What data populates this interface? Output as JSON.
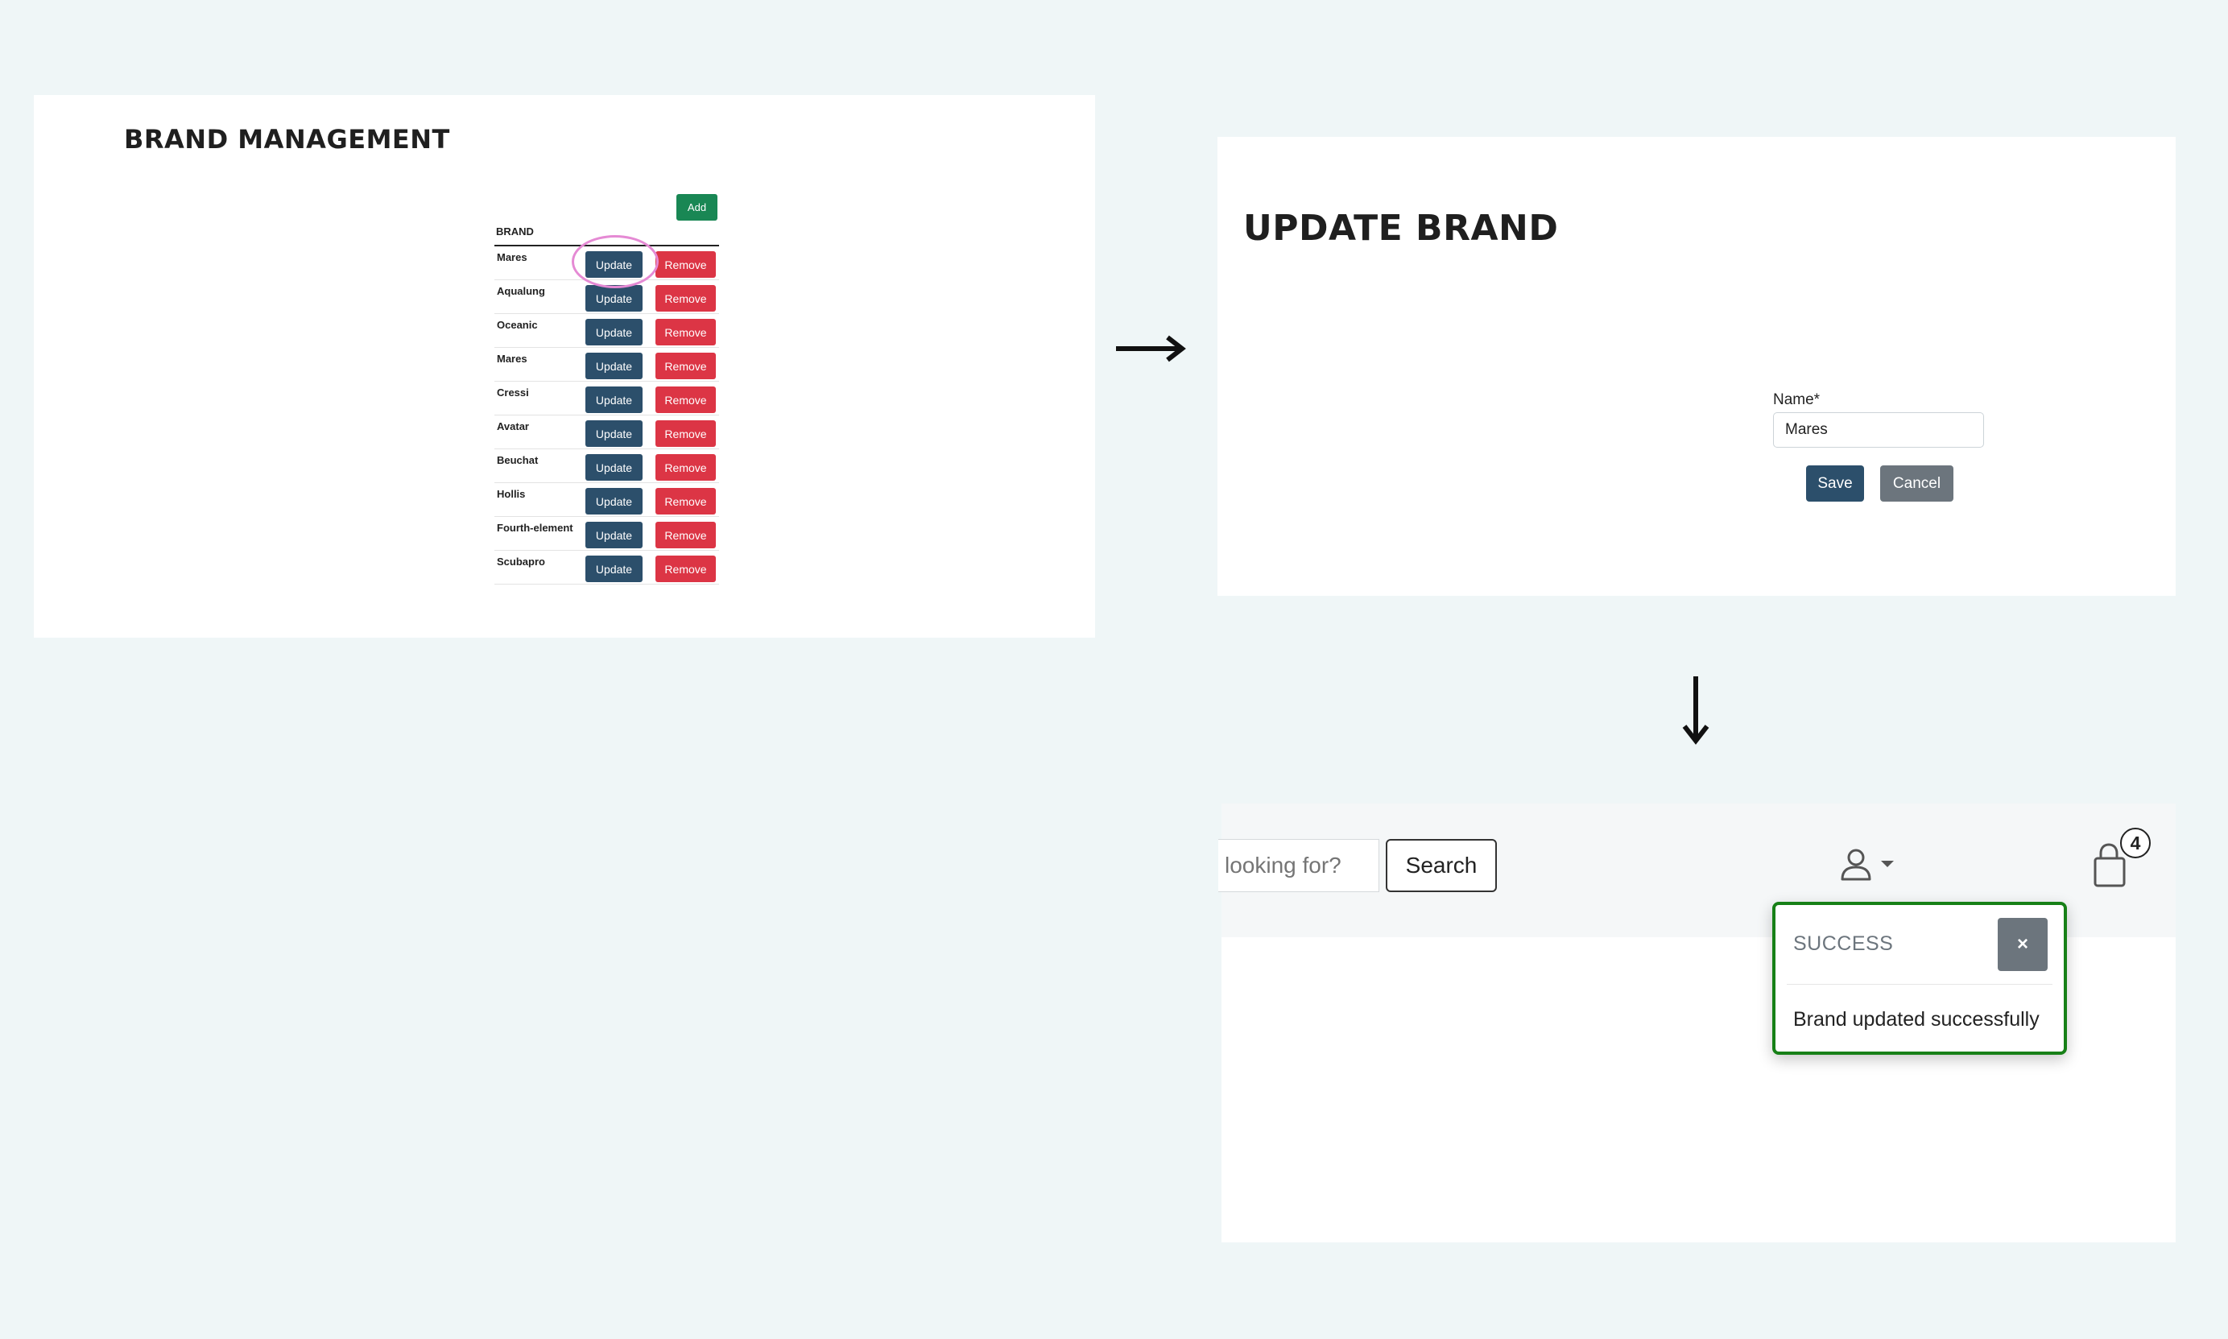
{
  "brand_management": {
    "title": "BRAND MANAGEMENT",
    "add_label": "Add",
    "column_header": "BRAND",
    "update_label": "Update",
    "remove_label": "Remove",
    "brands": [
      "Mares",
      "Aqualung",
      "Oceanic",
      "Mares",
      "Cressi",
      "Avatar",
      "Beuchat",
      "Hollis",
      "Fourth-element",
      "Scubapro"
    ],
    "highlighted_row": 0
  },
  "update_brand": {
    "title": "UPDATE BRAND",
    "name_label": "Name*",
    "name_value": "Mares",
    "save_label": "Save",
    "cancel_label": "Cancel"
  },
  "navbar": {
    "search_placeholder": "looking for?",
    "search_label": "Search",
    "cart_count": "4",
    "user_icon": "user-icon",
    "cart_icon": "shopping-bag-icon"
  },
  "toast": {
    "title": "SUCCESS",
    "close_label": "×",
    "message": "Brand updated successfully"
  },
  "colors": {
    "primary": "#2c4f6b",
    "danger": "#dc3545",
    "success": "#198754",
    "secondary": "#6c757d",
    "highlight": "#e58ad4",
    "toast_border": "#178017"
  }
}
